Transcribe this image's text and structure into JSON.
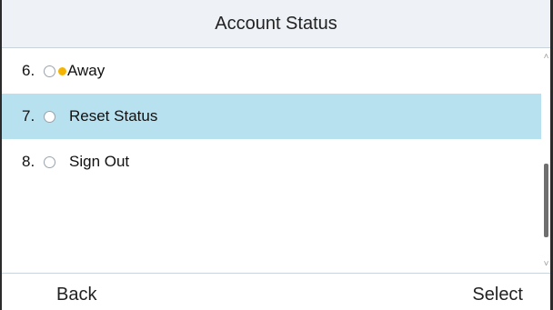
{
  "header": {
    "title": "Account Status"
  },
  "status_list": {
    "items": [
      {
        "number": "6.",
        "label": "Away",
        "presence_color": "#f4b400",
        "selected": false
      },
      {
        "number": "7.",
        "label": "Reset Status",
        "selected": true
      },
      {
        "number": "8.",
        "label": "Sign Out",
        "selected": false
      }
    ]
  },
  "softkeys": {
    "left": "Back",
    "right": "Select"
  },
  "colors": {
    "highlight": "#b8e1f0",
    "title_background": "#eef2f7"
  },
  "icons": {
    "radio": "radio-button-icon",
    "presence": "presence-dot-icon",
    "scroll_up": "chevron-up-icon",
    "scroll_down": "chevron-down-icon"
  }
}
